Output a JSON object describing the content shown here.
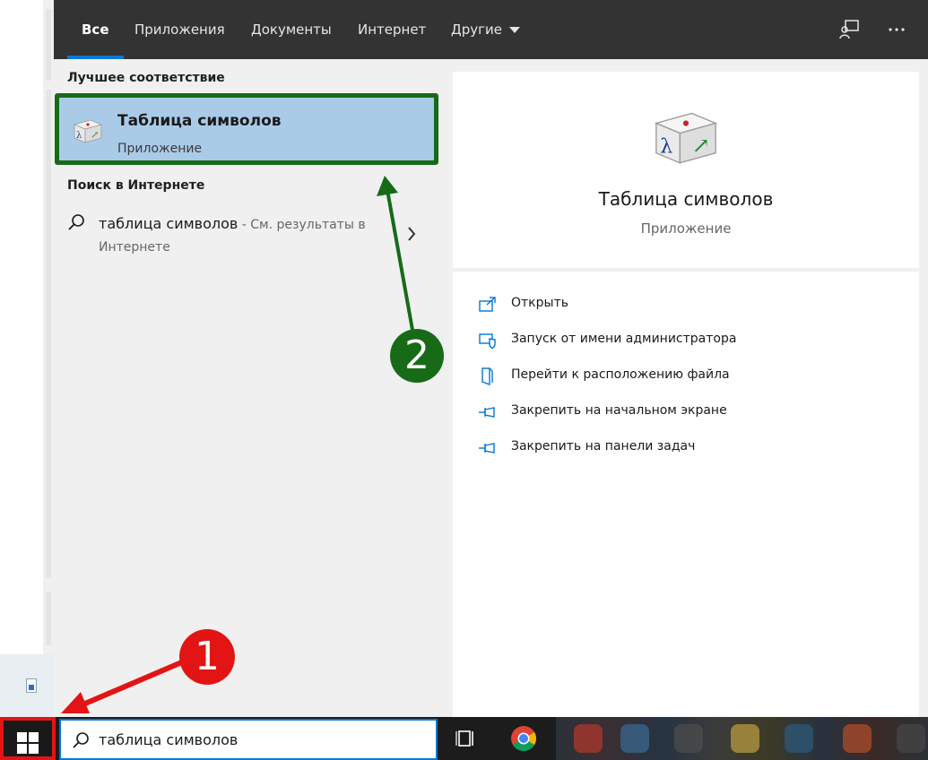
{
  "tabs": [
    {
      "label": "Все",
      "active": true
    },
    {
      "label": "Приложения"
    },
    {
      "label": "Документы"
    },
    {
      "label": "Интернет"
    },
    {
      "label": "Другие"
    }
  ],
  "best_match": {
    "section_title": "Лучшее соответствие",
    "name": "Таблица символов",
    "type": "Приложение"
  },
  "web_search": {
    "section_title": "Поиск в Интернете",
    "query": "таблица символов",
    "hint": " - См. результаты в",
    "hint_line2": "Интернете"
  },
  "preview": {
    "title": "Таблица символов",
    "subtitle": "Приложение",
    "actions": [
      {
        "label": "Открыть",
        "icon": "open-icon"
      },
      {
        "label": "Запуск от имени администратора",
        "icon": "shield-icon"
      },
      {
        "label": "Перейти к расположению файла",
        "icon": "file-location-icon"
      },
      {
        "label": "Закрепить на начальном экране",
        "icon": "pin-icon"
      },
      {
        "label": "Закрепить на панели задач",
        "icon": "pin-icon"
      }
    ]
  },
  "search_box": {
    "value": "таблица символов"
  },
  "annotations": {
    "badge1": "1",
    "badge2": "2"
  },
  "colors": {
    "highlight": "#a9cbe8",
    "highlight_border": "#176b17",
    "accent": "#0078d7",
    "annotation_red": "#e31414",
    "annotation_green": "#176b17"
  }
}
